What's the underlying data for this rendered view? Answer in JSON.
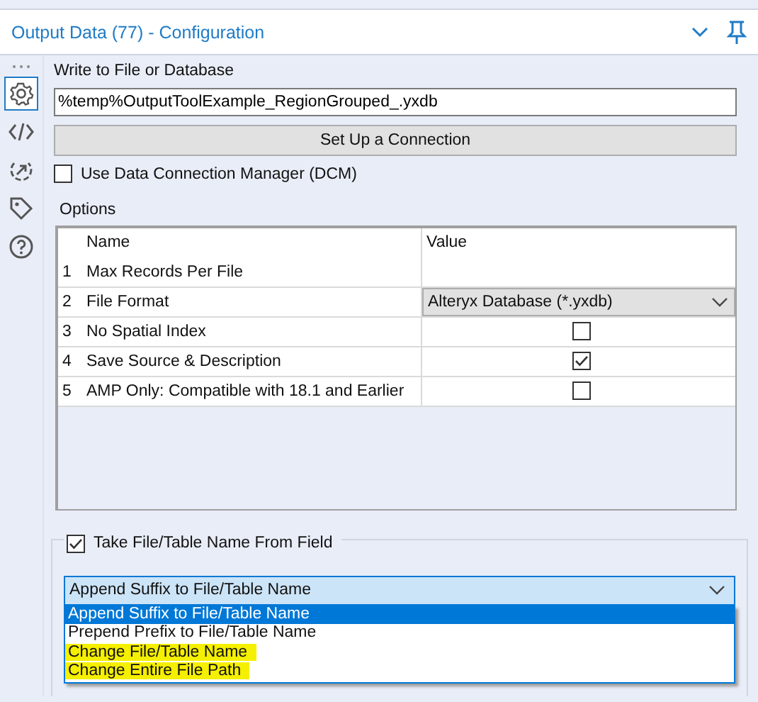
{
  "panel": {
    "title": "Output Data (77) - Configuration"
  },
  "rail": [
    {
      "kind": "gear",
      "selected": true
    },
    {
      "kind": "code",
      "selected": false
    },
    {
      "kind": "arrow",
      "selected": false
    },
    {
      "kind": "tag",
      "selected": false
    },
    {
      "kind": "help",
      "selected": false
    }
  ],
  "write_label": "Write to File or Database",
  "path_field": {
    "value": "%temp%OutputToolExample_RegionGrouped_.yxdb"
  },
  "connect_button": "Set Up a Connection",
  "dcm": {
    "label": "Use Data Connection Manager (DCM)",
    "checked": false
  },
  "options": {
    "label": "Options",
    "columns": [
      "Name",
      "Value"
    ],
    "rows": [
      {
        "number": "1",
        "name": "Max Records Per File",
        "kind": "text",
        "value": ""
      },
      {
        "number": "2",
        "name": "File Format",
        "kind": "dropdown",
        "value": "Alteryx Database (*.yxdb)"
      },
      {
        "number": "3",
        "name": "No Spatial Index",
        "kind": "checkbox",
        "checked": false
      },
      {
        "number": "4",
        "name": "Save Source & Description",
        "kind": "checkbox",
        "checked": true
      },
      {
        "number": "5",
        "name": "AMP Only: Compatible with 18.1 and Earlier",
        "kind": "checkbox",
        "checked": false
      }
    ]
  },
  "name_from_field": {
    "label": "Take File/Table Name From Field",
    "checked": true,
    "combo": {
      "value": "Append Suffix to File/Table Name",
      "expanded": true
    },
    "list": [
      {
        "label": "Append Suffix to File/Table Name",
        "selected": true,
        "highlighted": false
      },
      {
        "label": "Prepend Prefix to File/Table Name",
        "selected": false,
        "highlighted": false
      },
      {
        "label": "Change File/Table Name",
        "selected": false,
        "highlighted": true
      },
      {
        "label": "Change Entire File Path",
        "selected": false,
        "highlighted": true
      }
    ]
  }
}
